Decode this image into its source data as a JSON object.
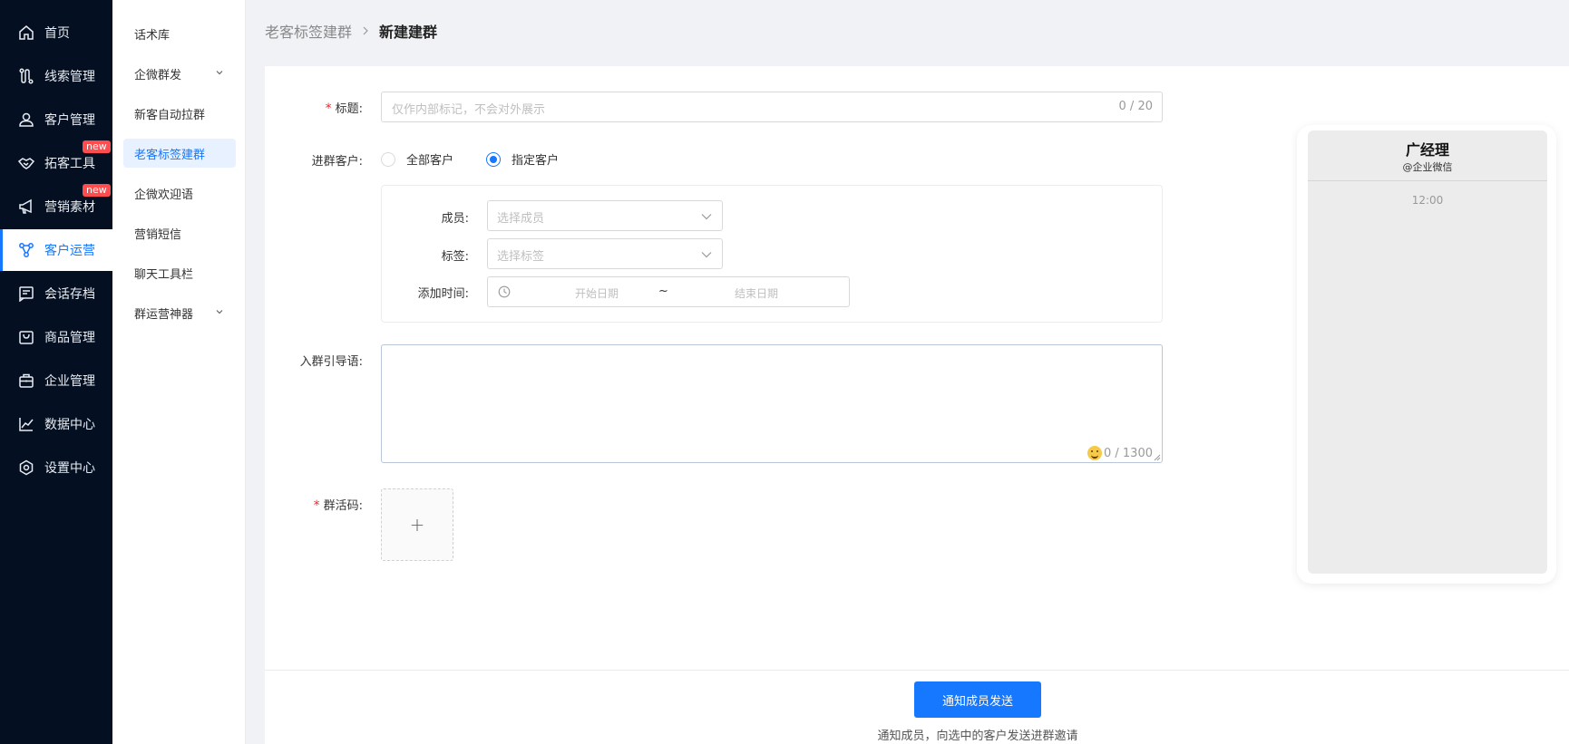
{
  "nav": {
    "items": [
      {
        "label": "首页",
        "icon": "home-icon"
      },
      {
        "label": "线索管理",
        "icon": "route-icon"
      },
      {
        "label": "客户管理",
        "icon": "user-icon"
      },
      {
        "label": "拓客工具",
        "icon": "handshake-icon",
        "badge": "new"
      },
      {
        "label": "营销素材",
        "icon": "megaphone-icon",
        "badge": "new"
      },
      {
        "label": "客户运营",
        "icon": "operation-icon",
        "active": true
      },
      {
        "label": "会话存档",
        "icon": "message-icon"
      },
      {
        "label": "商品管理",
        "icon": "bag-icon"
      },
      {
        "label": "企业管理",
        "icon": "briefcase-icon"
      },
      {
        "label": "数据中心",
        "icon": "chart-line-icon"
      },
      {
        "label": "设置中心",
        "icon": "settings-icon"
      }
    ]
  },
  "subnav": {
    "items": [
      {
        "label": "话术库"
      },
      {
        "label": "企微群发",
        "expandable": true
      },
      {
        "label": "新客自动拉群"
      },
      {
        "label": "老客标签建群",
        "active": true
      },
      {
        "label": "企微欢迎语"
      },
      {
        "label": "营销短信"
      },
      {
        "label": "聊天工具栏"
      },
      {
        "label": "群运营神器",
        "expandable": true
      }
    ]
  },
  "breadcrumb": {
    "parent": "老客标签建群",
    "current": "新建建群"
  },
  "form": {
    "title_label": "标题",
    "title_placeholder": "仅作内部标记，不会对外展示",
    "title_count": "0 / 20",
    "customers_label": "进群客户",
    "radio_all": "全部客户",
    "radio_specific": "指定客户",
    "selected_radio": "指定客户",
    "member_label": "成员",
    "member_placeholder": "选择成员",
    "tag_label": "标签",
    "tag_placeholder": "选择标签",
    "added_time_label": "添加时间",
    "start_date_placeholder": "开始日期",
    "date_separator": "~",
    "end_date_placeholder": "结束日期",
    "guide_label": "入群引导语",
    "guide_count": "0 / 1300",
    "qrcode_label": "群活码",
    "upload_symbol": "+",
    "colon": ":"
  },
  "footer": {
    "submit_label": "通知成员发送",
    "hint": "通知成员，向选中的客户发送进群邀请"
  },
  "preview": {
    "name": "广经理",
    "subtitle": "@企业微信",
    "time": "12:00"
  },
  "colors": {
    "primary": "#1677ff",
    "sidebar_bg": "#041022",
    "required": "#f5222d",
    "badge": "#ff4d4f"
  }
}
